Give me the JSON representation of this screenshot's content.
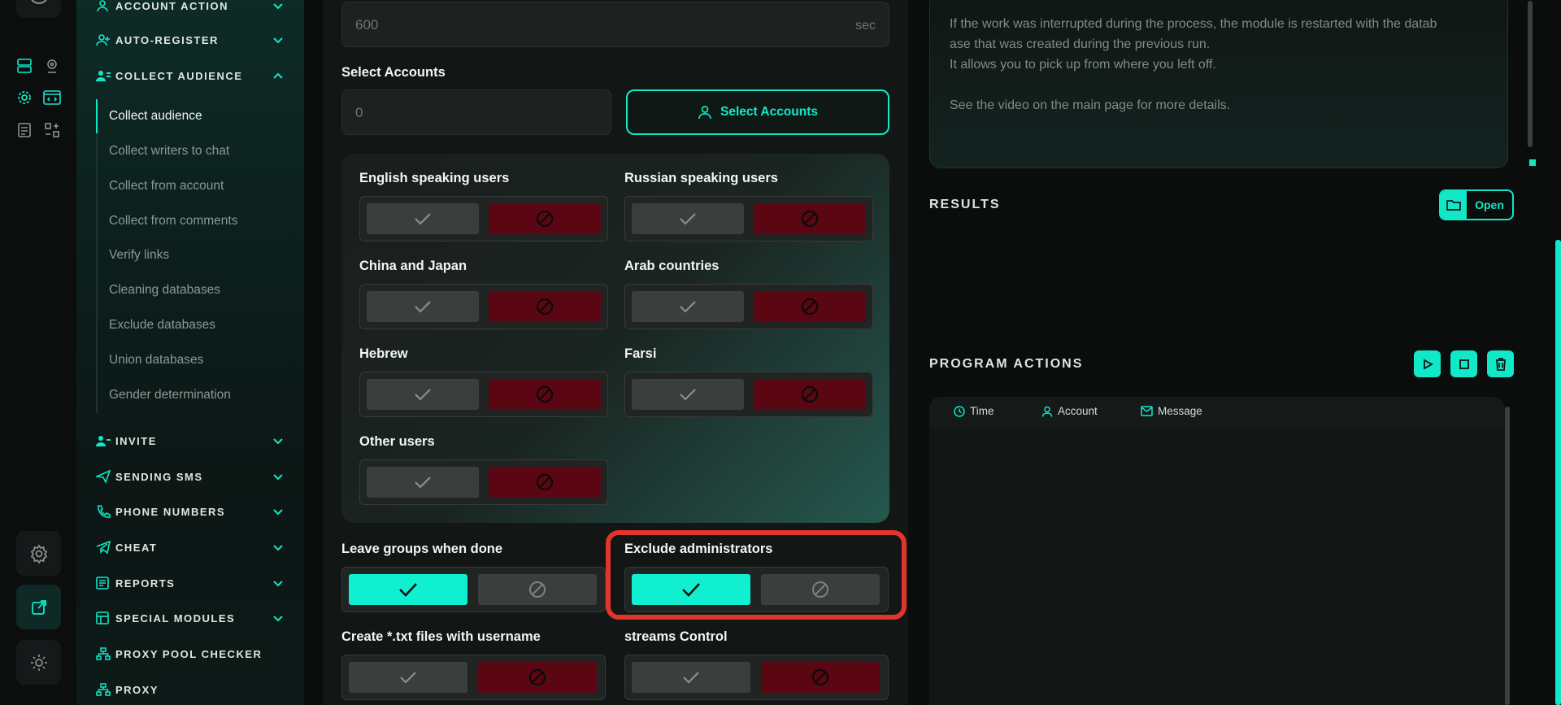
{
  "colors": {
    "accent": "#10e8c8",
    "danger": "#5a0713",
    "highlight": "#e0352c"
  },
  "sidebar": {
    "sections": [
      {
        "label": "ACCOUNT ACTION",
        "icon": "user-icon",
        "expanded": false
      },
      {
        "label": "AUTO-REGISTER",
        "icon": "user-plus-icon",
        "expanded": false
      },
      {
        "label": "COLLECT AUDIENCE",
        "icon": "users-icon",
        "expanded": true
      },
      {
        "label": "INVITE",
        "icon": "user-add-icon",
        "expanded": false
      },
      {
        "label": "SENDING SMS",
        "icon": "send-icon",
        "expanded": false
      },
      {
        "label": "PHONE NUMBERS",
        "icon": "phone-icon",
        "expanded": false
      },
      {
        "label": "CHEAT",
        "icon": "telegram-icon",
        "expanded": false
      },
      {
        "label": "REPORTS",
        "icon": "report-icon",
        "expanded": false
      },
      {
        "label": "SPECIAL MODULES",
        "icon": "modules-icon",
        "expanded": false
      },
      {
        "label": "PROXY POOL CHECKER",
        "icon": "network-icon"
      },
      {
        "label": "PROXY",
        "icon": "network-icon"
      }
    ],
    "collect_audience_items": [
      "Collect audience",
      "Collect writers to chat",
      "Collect from account",
      "Collect from comments",
      "Verify links",
      "Cleaning databases",
      "Exclude databases",
      "Union databases",
      "Gender determination"
    ],
    "active_item": "Collect audience"
  },
  "form": {
    "delay_value": "600",
    "delay_unit": "sec",
    "select_accounts_label": "Select Accounts",
    "accounts_count": "0",
    "select_accounts_button": "Select Accounts",
    "languages": [
      {
        "label": "English speaking users",
        "value": "excluded"
      },
      {
        "label": "Russian speaking users",
        "value": "excluded"
      },
      {
        "label": "China and Japan",
        "value": "excluded"
      },
      {
        "label": "Arab countries",
        "value": "excluded"
      },
      {
        "label": "Hebrew",
        "value": "excluded"
      },
      {
        "label": "Farsi",
        "value": "excluded"
      },
      {
        "label": "Other users",
        "value": "excluded"
      }
    ],
    "options": [
      {
        "label": "Leave groups when done",
        "value": "enabled"
      },
      {
        "label": "Exclude administrators",
        "value": "enabled"
      },
      {
        "label": "Create *.txt files with username",
        "value": "disabled"
      },
      {
        "label": "streams Control",
        "value": "disabled"
      }
    ]
  },
  "info": {
    "line1": "If the work was interrupted during the process, the module is restarted with the datab",
    "line2": "ase that was created during the previous run.",
    "line3": "It allows you to pick up from where you left off.",
    "line4": "See the video on the main page for more details."
  },
  "results": {
    "title": "RESULTS",
    "open_label": "Open"
  },
  "program_actions": {
    "title": "PROGRAM ACTIONS",
    "columns": [
      "Time",
      "Account",
      "Message"
    ]
  }
}
